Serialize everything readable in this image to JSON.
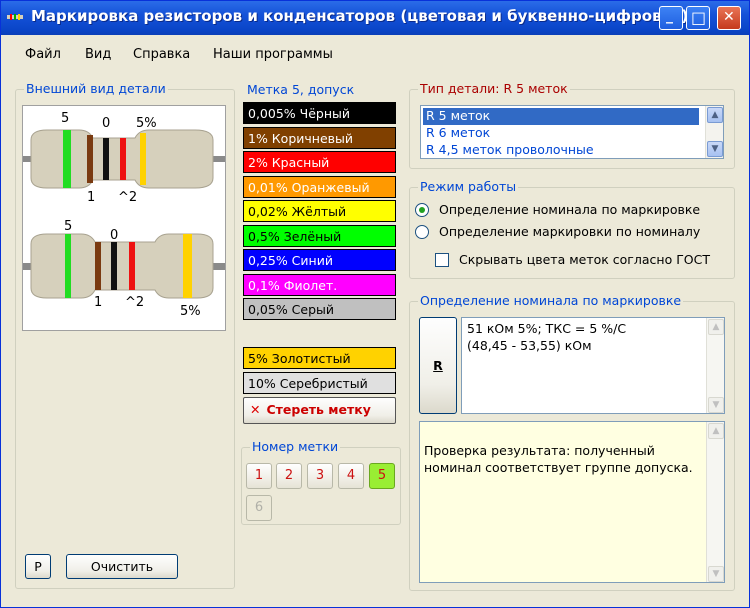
{
  "window": {
    "title": "Маркировка резисторов и конденсаторов (цветовая и буквенно-цифровая)",
    "controls": {
      "minimize": "_",
      "maximize": "□",
      "close": "✕"
    }
  },
  "menu": [
    "Файл",
    "Вид",
    "Справка",
    "Наши программы"
  ],
  "appearance": {
    "title": "Внешний вид детали",
    "resistor1": {
      "top_labels": [
        "5",
        "0",
        "5%"
      ],
      "bottom_labels": [
        "1",
        "^2"
      ]
    },
    "resistor2": {
      "top_labels": [
        "5",
        "0"
      ],
      "bottom_labels": [
        "1",
        "^2",
        "5%"
      ]
    },
    "colors": {
      "green": "#22dd22",
      "brown": "#7a3a10",
      "black": "#111111",
      "red": "#ee1111",
      "gold": "#ffd200",
      "body": "#d6d0bc"
    }
  },
  "bands": {
    "title": "Метка 5, допуск",
    "items": [
      {
        "label": "0,005% Чёрный",
        "bg": "#000000",
        "fg": "#ffffff"
      },
      {
        "label": "1% Коричневый",
        "bg": "#804000",
        "fg": "#ffffff"
      },
      {
        "label": "2% Красный",
        "bg": "#ff0000",
        "fg": "#ffffff"
      },
      {
        "label": "0,01% Оранжевый",
        "bg": "#ff9900",
        "fg": "#ffffff"
      },
      {
        "label": "0,02% Жёлтый",
        "bg": "#ffff00",
        "fg": "#000000"
      },
      {
        "label": "0,5% Зелёный",
        "bg": "#00ff00",
        "fg": "#000000"
      },
      {
        "label": "0,25% Синий",
        "bg": "#0000ff",
        "fg": "#ffffff"
      },
      {
        "label": "0,1% Фиолет.",
        "bg": "#ff00ff",
        "fg": "#ffffff"
      },
      {
        "label": "0,05% Серый",
        "bg": "#c0c0c0",
        "fg": "#000000"
      },
      {
        "label": "5% Золотистый",
        "bg": "#ffd200",
        "fg": "#000000"
      },
      {
        "label": "10% Серебристый",
        "bg": "#e0e0e0",
        "fg": "#000000"
      }
    ],
    "clear_label": "Стереть метку",
    "clear_icon": "✕"
  },
  "band_number": {
    "title": "Номер метки",
    "buttons": [
      "1",
      "2",
      "3",
      "4",
      "5",
      "6"
    ],
    "selected": "5"
  },
  "part_type": {
    "title": "Тип детали: R 5 меток",
    "options": [
      "R 5 меток",
      "R 6 меток",
      "R 4,5 меток проволочные"
    ],
    "selected_index": 0
  },
  "mode": {
    "title": "Режим работы",
    "options": [
      "Определение номинала по маркировке",
      "Определение маркировки по номиналу"
    ],
    "selected_index": 0,
    "hide_gost_label": "Скрывать цвета меток согласно ГОСТ",
    "hide_gost_checked": false
  },
  "result": {
    "title": "Определение номинала по маркировке",
    "r_button": "R",
    "lines": [
      "51 кОм 5%; ТКС = 5 %/С",
      "(48,45 - 53,55) кОм"
    ],
    "check_lines": [
      "Проверка результата: полученный",
      "номинал соответствует группе допуска."
    ]
  },
  "bottom": {
    "p_button": "P",
    "clear_button": "Очистить"
  },
  "scroll_glyphs": {
    "up": "▲",
    "down": "▼"
  }
}
